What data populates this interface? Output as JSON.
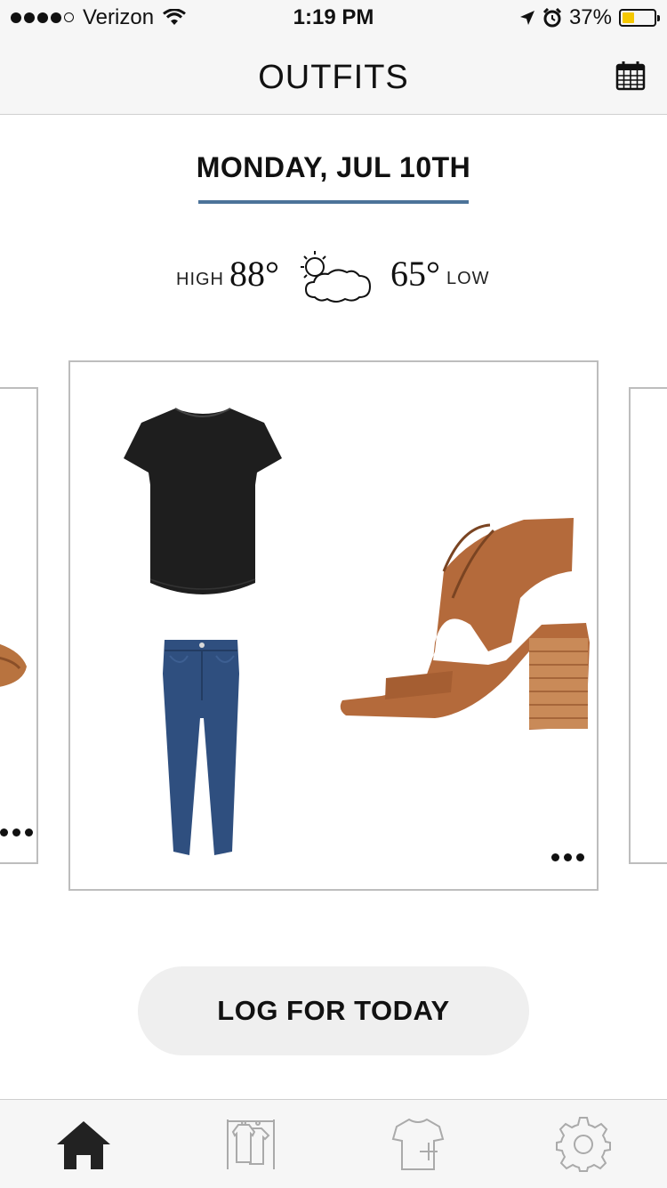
{
  "status_bar": {
    "carrier": "Verizon",
    "time": "1:19 PM",
    "battery": "37%",
    "battery_level": 0.37,
    "icons": [
      "signal-dots-icon",
      "wifi-icon",
      "location-arrow-icon",
      "alarm-icon",
      "battery-icon"
    ]
  },
  "nav": {
    "title": "OUTFITS",
    "calendar_icon": "calendar-icon"
  },
  "date": {
    "label": "MONDAY, JUL 10TH",
    "accent_color": "#4c7399"
  },
  "weather": {
    "high_label": "HIGH",
    "high_temp": "88°",
    "low_temp": "65°",
    "low_label": "LOW",
    "icon": "partly-cloudy-icon"
  },
  "outfit": {
    "items": [
      {
        "name": "black-tshirt",
        "color": "#1e1e1e"
      },
      {
        "name": "blue-jeans",
        "color": "#2f4f7f"
      },
      {
        "name": "tan-heeled-sandal",
        "color": "#b46a3b"
      }
    ]
  },
  "log_button": {
    "label": "LOG FOR TODAY"
  },
  "tab_bar": {
    "tabs": [
      {
        "icon": "home-icon",
        "active": true
      },
      {
        "icon": "closet-icon",
        "active": false
      },
      {
        "icon": "add-clothing-icon",
        "active": false
      },
      {
        "icon": "settings-gear-icon",
        "active": false
      }
    ]
  }
}
